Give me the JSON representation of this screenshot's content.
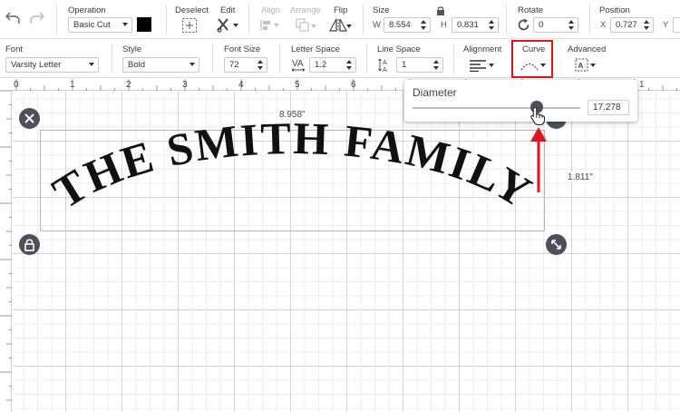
{
  "toolbar_top": {
    "operation": {
      "label": "Operation",
      "value": "Basic Cut",
      "swatch_color": "#000000"
    },
    "deselect": {
      "label": "Deselect"
    },
    "edit": {
      "label": "Edit"
    },
    "align": {
      "label": "Align"
    },
    "arrange": {
      "label": "Arrange"
    },
    "flip": {
      "label": "Flip"
    },
    "size": {
      "label": "Size",
      "w_label": "W",
      "w_value": "8.554",
      "h_label": "H",
      "h_value": "0.831"
    },
    "rotate": {
      "label": "Rotate",
      "value": "0"
    },
    "position": {
      "label": "Position",
      "x_label": "X",
      "x_value": "0.727",
      "y_label": "Y"
    }
  },
  "toolbar_text": {
    "font": {
      "label": "Font",
      "value": "Varsity Letter"
    },
    "style": {
      "label": "Style",
      "value": "Bold"
    },
    "font_size": {
      "label": "Font Size",
      "value": "72"
    },
    "letter_space": {
      "label": "Letter Space",
      "value": "1.2"
    },
    "line_space": {
      "label": "Line Space",
      "value": "1"
    },
    "alignment": {
      "label": "Alignment"
    },
    "curve": {
      "label": "Curve"
    },
    "advanced": {
      "label": "Advanced"
    }
  },
  "rulers": {
    "horizontal": [
      "0",
      "1",
      "2",
      "3",
      "4",
      "5",
      "6",
      "1"
    ]
  },
  "canvas": {
    "text": "THE SMITH FAMILY",
    "width_label": "8.958\"",
    "height_label": "1.811\""
  },
  "curve_popup": {
    "title": "Diameter",
    "value": "17.278",
    "slider_fraction": 0.74
  },
  "colors": {
    "highlight": "#e0141f",
    "arrow": "#e0141f",
    "handle": "#4d5059",
    "text_fill": "#111111"
  }
}
